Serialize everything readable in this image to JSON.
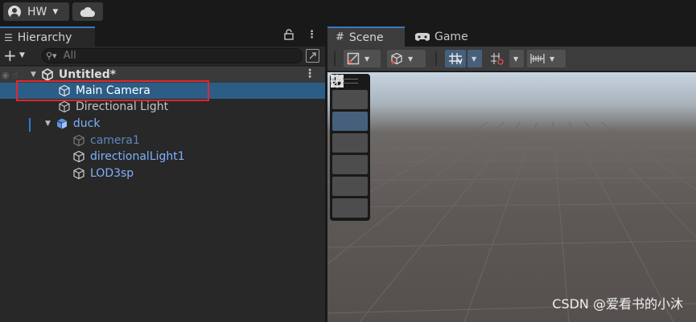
{
  "topbar": {
    "account_label": "HW",
    "account_icon": "account-icon",
    "cloud_icon": "cloud-icon"
  },
  "hierarchy": {
    "tab_label": "Hierarchy",
    "search_placeholder": "All",
    "items": [
      {
        "label": "Untitled*",
        "kind": "scene"
      },
      {
        "label": "Main Camera",
        "kind": "gameobject",
        "selected": true
      },
      {
        "label": "Directional Light",
        "kind": "gameobject"
      },
      {
        "label": "duck",
        "kind": "prefab-root"
      },
      {
        "label": "camera1",
        "kind": "prefab-child-inactive"
      },
      {
        "label": "directionalLight1",
        "kind": "prefab-child"
      },
      {
        "label": "LOD3sp",
        "kind": "prefab-child"
      }
    ]
  },
  "scene_view": {
    "tabs": [
      {
        "label": "Scene",
        "icon": "grid-icon",
        "active": true
      },
      {
        "label": "Game",
        "icon": "gamepad-icon",
        "active": false
      }
    ],
    "tools": [
      "hand-tool",
      "move-tool",
      "rotate-tool",
      "scale-tool",
      "rect-tool",
      "transform-tool"
    ],
    "active_tool": "move-tool"
  },
  "watermark": "CSDN @爱看书的小沐",
  "colors": {
    "selection": "#2c5d87",
    "prefab_text": "#7fb0ff",
    "highlight_box": "#e0282e",
    "tab_accent": "#3a79bb"
  }
}
